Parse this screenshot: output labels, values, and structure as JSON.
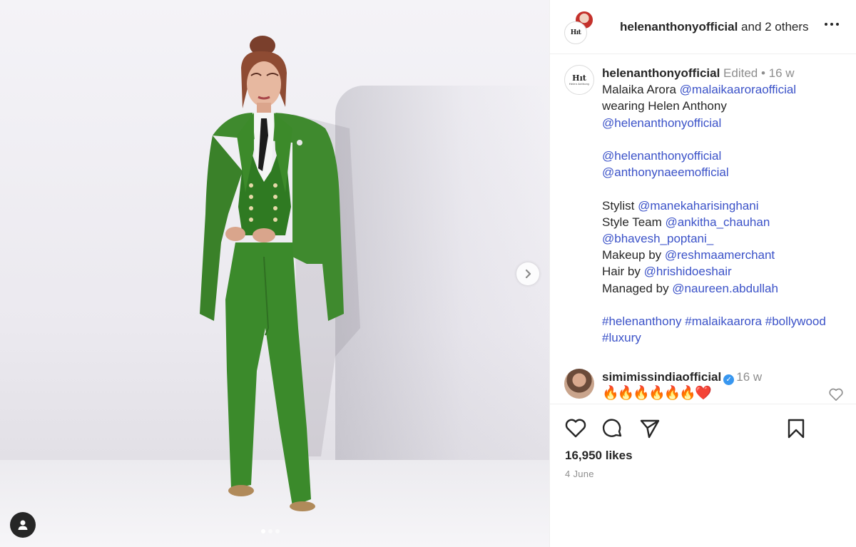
{
  "header": {
    "username": "helenanthonyofficial",
    "collaborators_text": "and 2 others",
    "avatar_monogram": "Hıt"
  },
  "caption": {
    "username": "helenanthonyofficial",
    "edited": "Edited",
    "separator": "•",
    "age": "16 w",
    "avatar_monogram": "Hıt",
    "avatar_subtext": "Helen Anthony",
    "line1_text": "Malaika Arora ",
    "line1_link": "@malaikaaroraofficial",
    "line2_text": "wearing Helen Anthony",
    "line3_link": "@helenanthonyofficial",
    "line5_link": "@helenanthonyofficial",
    "line6_link": "@anthonynaeemofficial",
    "stylist_label": "Stylist ",
    "stylist_link": "@manekaharisinghani",
    "style_team_label": "Style Team ",
    "style_team_link1": "@ankitha_chauhan",
    "style_team_link2": "@bhavesh_poptani_",
    "makeup_label": "Makeup by ",
    "makeup_link": "@reshmaamerchant",
    "hair_label": "Hair by ",
    "hair_link": "@hrishidoeshair",
    "managed_label": "Managed by ",
    "managed_link": "@naureen.abdullah",
    "hashtag1": "#helenanthony",
    "hashtag2": "#malaikaarora",
    "hashtag3": "#bollywood",
    "hashtag4": "#luxury"
  },
  "reply": {
    "username": "simimissindiaofficial",
    "age": "16 w",
    "text": "🔥🔥🔥🔥🔥🔥",
    "heart": "❤️"
  },
  "footer": {
    "likes": "16,950 likes",
    "date": "4 June"
  },
  "carousel": {
    "slide_count": 3,
    "active_slide": 1
  },
  "icons": {
    "like": "heart-icon",
    "comment": "comment-icon",
    "share": "share-icon",
    "save": "bookmark-icon",
    "next": "chevron-right-icon",
    "tags": "user-tag-icon",
    "more": "more-options-icon"
  },
  "colors": {
    "link": "#3b52c8",
    "meta": "#8e8e8e",
    "text": "#262626",
    "suit_green": "#3f8a2e",
    "verified": "#3897f0"
  }
}
